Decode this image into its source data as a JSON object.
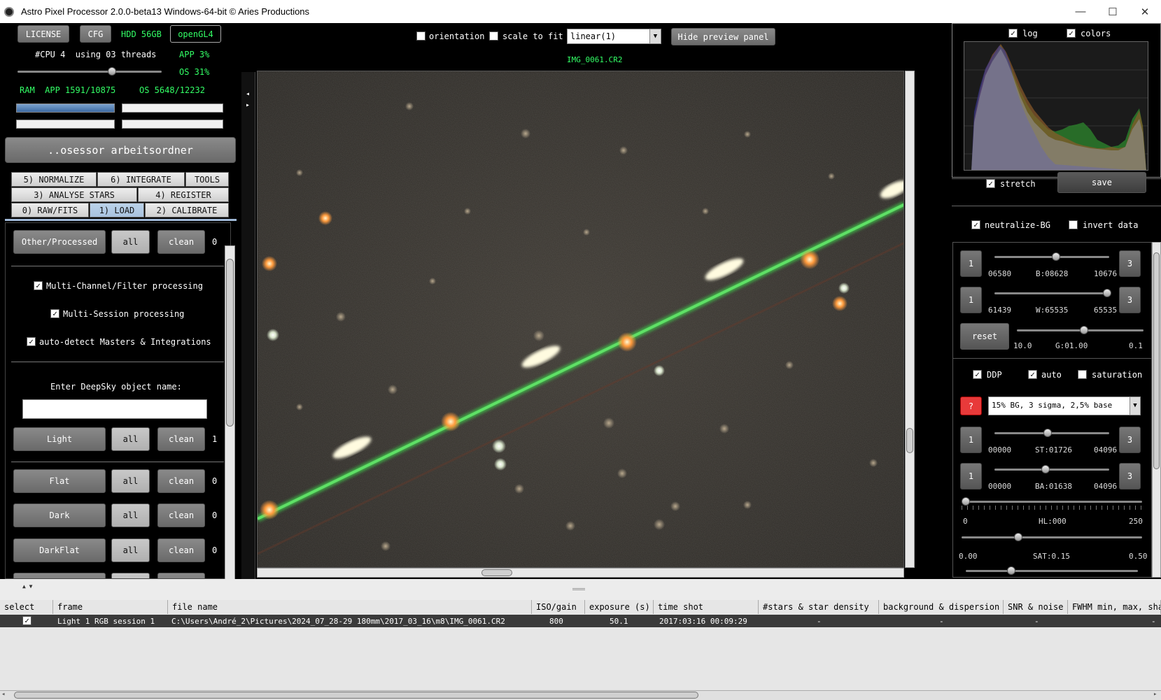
{
  "window": {
    "title": "Astro Pixel Processor 2.0.0-beta13 Windows-64-bit © Aries Productions",
    "minimize": "—",
    "maximize": "☐",
    "close": "✕"
  },
  "top_left": {
    "license": "LICENSE",
    "cfg": "CFG",
    "hdd": "HDD 56GB",
    "opengl": "openGL4",
    "cpu": "#CPU 4  using 03 threads",
    "app_cpu": "APP 3%",
    "os_cpu": "OS 31%",
    "ram_app": "RAM  APP 1591/10875",
    "ram_os": "OS 5648/12232",
    "working_dir": "..osessor arbeitsordner"
  },
  "tabs": {
    "normalize": "5) NORMALIZE",
    "integrate": "6) INTEGRATE",
    "tools": "TOOLS",
    "analyse": "3) ANALYSE STARS",
    "register": "4) REGISTER",
    "rawfits": "0) RAW/FITS",
    "load": "1) LOAD",
    "calibrate": "2) CALIBRATE"
  },
  "load_panel": {
    "other_btn": "Other/Processed",
    "all": "all",
    "clean": "clean",
    "other_count": "0",
    "multichannel": "Multi-Channel/Filter processing",
    "multisession": "Multi-Session processing",
    "autodetect": "auto-detect Masters & Integrations",
    "deepsky_label": "Enter DeepSky object name:",
    "deepsky_value": "",
    "light_btn": "Light",
    "light_count": "1",
    "flat_btn": "Flat",
    "flat_count": "0",
    "dark_btn": "Dark",
    "dark_count": "0",
    "darkflat_btn": "DarkFlat",
    "darkflat_count": "0",
    "check": "✓"
  },
  "preview_toolbar": {
    "orientation": "orientation",
    "scale": "scale to fit",
    "mode": "linear(1)",
    "hide": "Hide preview panel",
    "filename": "IMG_0061.CR2"
  },
  "histogram": {
    "log": "log",
    "colors": "colors"
  },
  "right_panel": {
    "stretch": "stretch",
    "save": "save",
    "neutralize": "neutralize-BG",
    "invert": "invert data",
    "one": "1",
    "three": "3",
    "b_min": "06580",
    "b_val": "B:08628",
    "b_max": "10676",
    "w_min": "61439",
    "w_val": "W:65535",
    "w_max": "65535",
    "reset": "reset",
    "g_min": "10.0",
    "g_val": "G:01.00",
    "g_max": "0.1",
    "ddp": "DDP",
    "auto": "auto",
    "saturation": "saturation",
    "q": "?",
    "ddp_mode": "15% BG, 3 sigma, 2,5% base",
    "st_min": "00000",
    "st_val": "ST:01726",
    "st_max": "04096",
    "ba_min": "00000",
    "ba_val": "BA:01638",
    "ba_max": "04096",
    "hl_min": "0",
    "hl_val": "HL:000",
    "hl_max": "250",
    "sat_min": "0.00",
    "sat_val": "SAT:0.15",
    "sat_max": "0.50"
  },
  "table": {
    "headers": [
      "select",
      "frame",
      "file name",
      "ISO/gain",
      "exposure (s)",
      "time shot",
      "#stars & star density",
      "background & dispersion",
      "SNR & noise",
      "FWHM min, max, sha"
    ],
    "row": {
      "frame": "Light 1 RGB session 1",
      "file": "C:\\Users\\André_2\\Pictures\\2024_07_28-29 180mm\\2017_03_16\\m8\\IMG_0061.CR2",
      "iso": "800",
      "exposure": "50.1",
      "time": "2017:03:16 00:09:29",
      "stars": "-",
      "bg": "-",
      "snr": "-",
      "fwhm": "-"
    }
  }
}
